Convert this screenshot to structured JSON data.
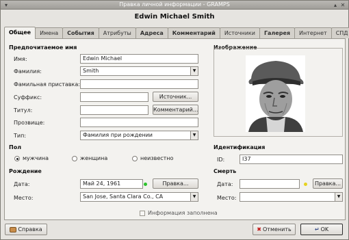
{
  "window": {
    "title": "Правка личной информации - GRAMPS",
    "heading": "Edwin Michael Smith"
  },
  "tabs": [
    {
      "label": "Общее",
      "active": true,
      "bold": true
    },
    {
      "label": "Имена",
      "bold": false
    },
    {
      "label": "События",
      "bold": true
    },
    {
      "label": "Атрибуты",
      "bold": false
    },
    {
      "label": "Адреса",
      "bold": true
    },
    {
      "label": "Комментарий",
      "bold": true
    },
    {
      "label": "Источники",
      "bold": false
    },
    {
      "label": "Галерея",
      "bold": true
    },
    {
      "label": "Интернет",
      "bold": false
    },
    {
      "label": "СПД",
      "bold": false
    }
  ],
  "preferred": {
    "section": "Предпочитаемое имя",
    "name_label": "Имя:",
    "name_value": "Edwin Michael",
    "surname_label": "Фамилия:",
    "surname_value": "Smith",
    "prefix_label": "Фамильная приставка:",
    "prefix_value": "",
    "suffix_label": "Суффикс:",
    "suffix_value": "",
    "title_label": "Титул:",
    "title_value": "",
    "nick_label": "Прозвище:",
    "nick_value": "",
    "type_label": "Тип:",
    "type_value": "Фамилия при рождении",
    "source_button": "Источник...",
    "comment_button": "Комментарий..."
  },
  "image": {
    "section": "Изображение"
  },
  "gender": {
    "section": "Пол",
    "options": [
      {
        "label": "мужчина",
        "selected": true
      },
      {
        "label": "женщина",
        "selected": false
      },
      {
        "label": "неизвестно",
        "selected": false
      }
    ]
  },
  "identification": {
    "section": "Идентификация",
    "id_label": "ID:",
    "id_value": "I37"
  },
  "birth": {
    "section": "Рождение",
    "date_label": "Дата:",
    "date_value": "Май 24, 1961",
    "place_label": "Место:",
    "place_value": "San Jose, Santa Clara Co., CA",
    "edit_button": "Правка...",
    "status_color": "#2cc22c"
  },
  "death": {
    "section": "Смерть",
    "date_label": "Дата:",
    "date_value": "",
    "place_label": "Место:",
    "place_value": "",
    "edit_button": "Правка...",
    "status_color": "#e6d21e"
  },
  "complete_label": "Информация заполнена",
  "footer": {
    "help": "Справка",
    "cancel": "Отменить",
    "ok": "OK"
  }
}
